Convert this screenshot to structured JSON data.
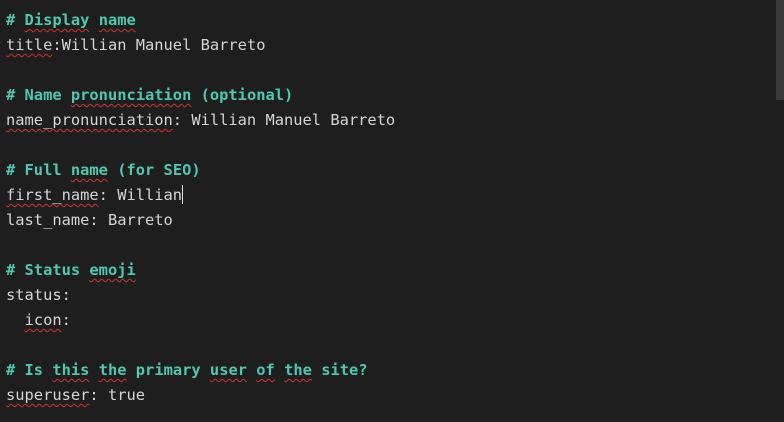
{
  "colors": {
    "background": "#1e1e1e",
    "comment": "#4ec9b0",
    "text": "#d4d4d4",
    "spellcheck_underline": "#d03030"
  },
  "lines": {
    "l1": {
      "hash": "# ",
      "w1": "Display",
      "sp": " ",
      "w2": "name"
    },
    "l2": {
      "key": "title",
      "rest": ":Willian Manuel Barreto"
    },
    "l4": {
      "hash": "# Name ",
      "w1": "pronunciation",
      "rest": " (optional)"
    },
    "l5": {
      "key": "name_pronunciation",
      "rest": ": Willian Manuel Barreto"
    },
    "l7": {
      "hash": "# Full ",
      "w1": "name",
      "rest": " (for SEO)"
    },
    "l8": {
      "key": "first_name",
      "rest": ": Willian"
    },
    "l9": {
      "key": "last_name",
      "rest": ": Barreto"
    },
    "l11": {
      "hash": "# Status ",
      "w1": "emoji"
    },
    "l12": {
      "key": "status",
      "rest": ":"
    },
    "l13": {
      "indent": "  ",
      "key": "icon",
      "rest": ":"
    },
    "l15": {
      "hash": "# Is ",
      "w1": "this",
      "t1": " ",
      "w2": "the",
      "t2": " primary ",
      "w3": "user",
      "t3": " ",
      "w4": "of",
      "t4": " ",
      "w5": "the",
      "t5": " site?"
    },
    "l16": {
      "key": "superuser",
      "rest": ": true"
    }
  }
}
